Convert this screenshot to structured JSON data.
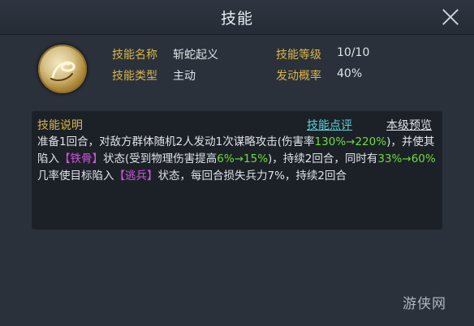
{
  "window": {
    "title": "技能"
  },
  "skill": {
    "name_label": "技能名称",
    "name_value": "斩蛇起义",
    "level_label": "技能等级",
    "level_value": "10/10",
    "type_label": "技能类型",
    "type_value": "主动",
    "trigger_label": "发动概率",
    "trigger_value": "40%"
  },
  "description": {
    "title": "技能说明",
    "review_link": "技能点评",
    "preview_link": "本级预览",
    "segments": {
      "s1": "准备1回合，对敌方群体随机2人发动1次谋略攻击(伤害率",
      "g1": "130%→220%",
      "s2": ")，并使其陷入",
      "p1": "【铁骨】",
      "s3": "状态(受到物理伤害提高",
      "g2": "6%→15%",
      "s4": ")，持续2回合，同时有",
      "g3": "33%→60%",
      "s5": "几率使目标陷入",
      "p2": "【逃兵】",
      "s6": "状态，每回合损失兵力7%，持续2回合"
    }
  },
  "watermark": {
    "text": "游侠网"
  }
}
